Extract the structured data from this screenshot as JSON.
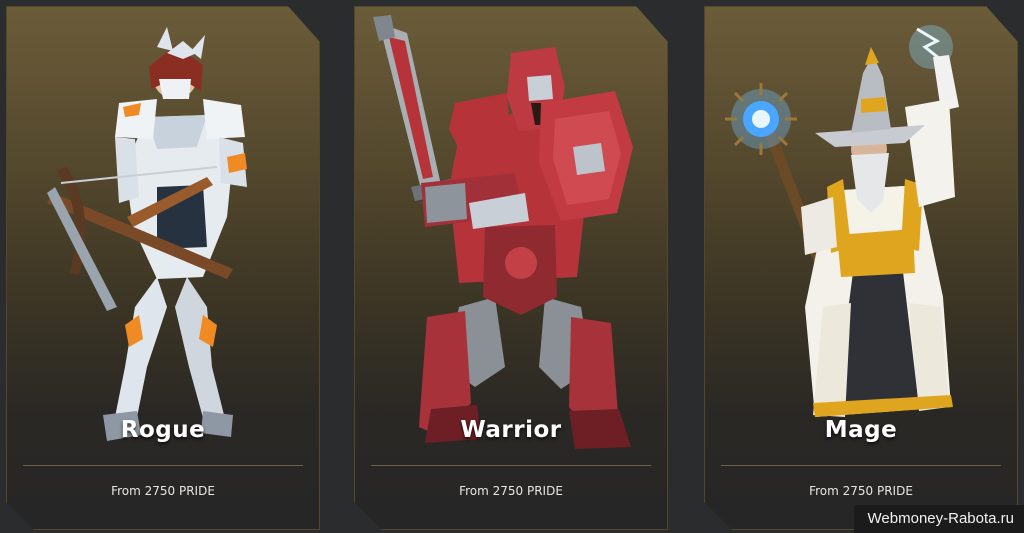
{
  "cards": [
    {
      "name": "Rogue",
      "price": "From 2750 PRIDE"
    },
    {
      "name": "Warrior",
      "price": "From 2750 PRIDE"
    },
    {
      "name": "Mage",
      "price": "From 2750 PRIDE"
    }
  ],
  "watermark": "Webmoney-Rabota.ru",
  "colors": {
    "card_top": "#6b5c39",
    "card_bottom": "#262626",
    "page_bg": "#2b2c2e",
    "rogue_accent": "#f08a24",
    "warrior_accent": "#b7333a",
    "mage_accent": "#e0a51e"
  }
}
